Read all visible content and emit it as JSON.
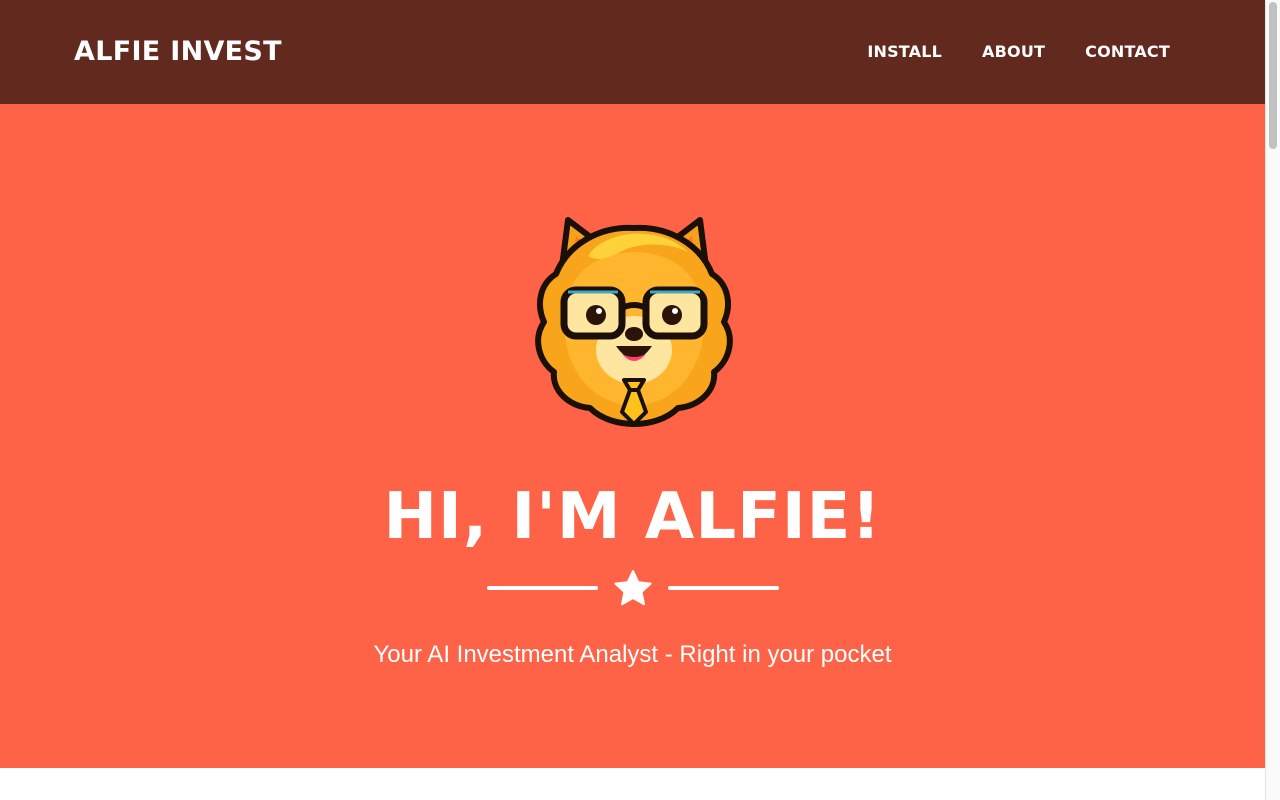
{
  "navbar": {
    "brand": "ALFIE INVEST",
    "links": [
      {
        "label": "INSTALL"
      },
      {
        "label": "ABOUT"
      },
      {
        "label": "CONTACT"
      }
    ]
  },
  "hero": {
    "title": "HI, I'M ALFIE!",
    "subtitle": "Your AI Investment Analyst - Right in your pocket",
    "avatar_icon": "pomeranian-dog-mascot-with-glasses-and-tie",
    "divider_icon": "star-icon"
  },
  "colors": {
    "navbar_bg": "#62291f",
    "hero_bg": "#ff6347",
    "text": "#ffffff"
  }
}
